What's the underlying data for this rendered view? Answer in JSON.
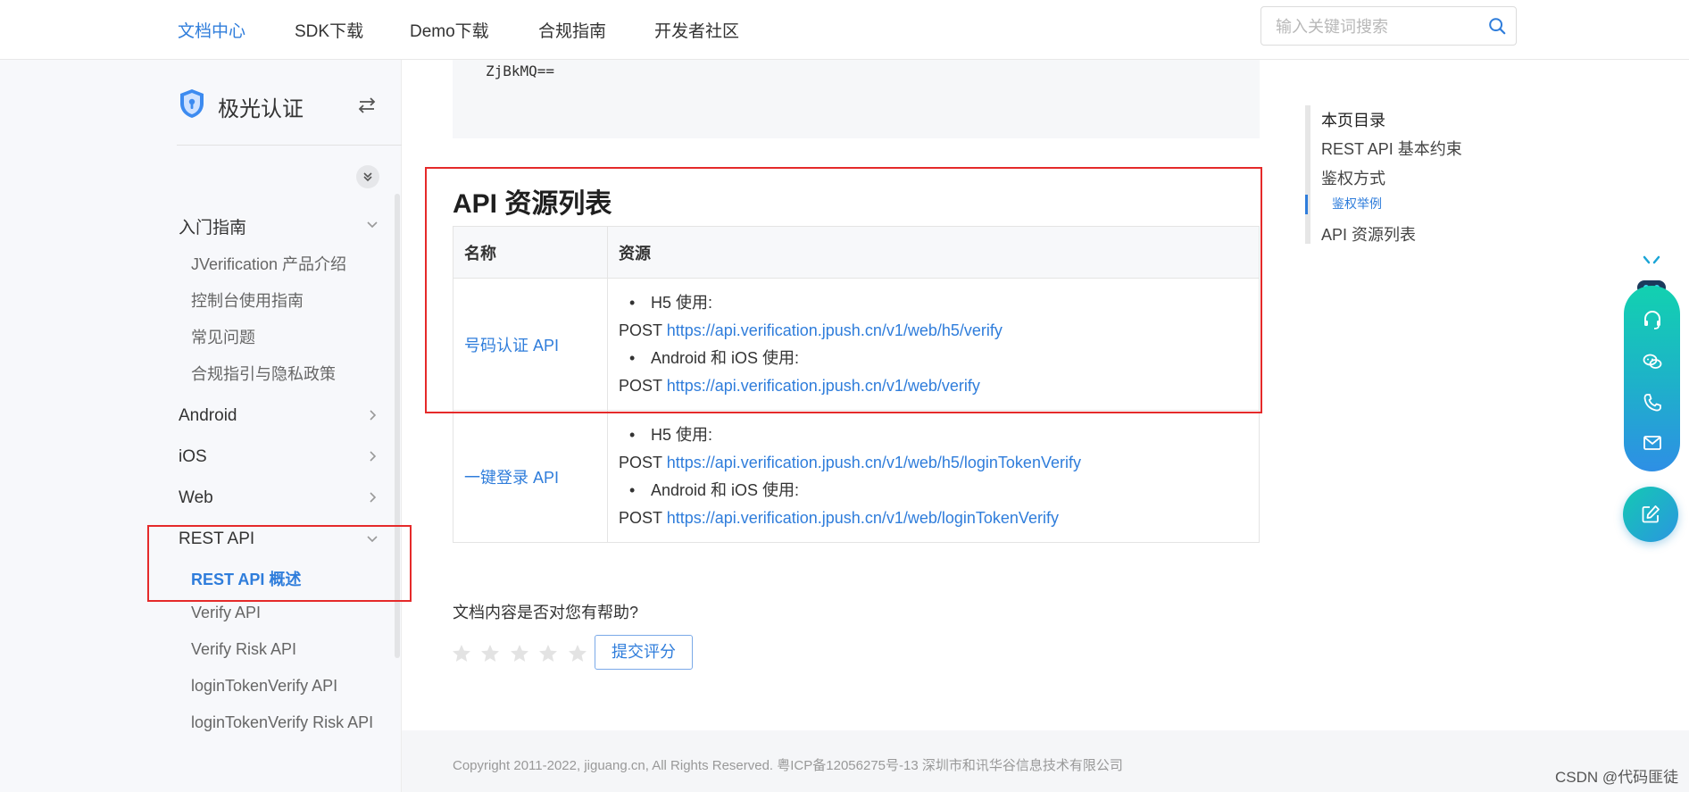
{
  "topnav": {
    "items": [
      "文档中心",
      "SDK下载",
      "Demo下载",
      "合规指南",
      "开发者社区"
    ],
    "search_placeholder": "输入关键词搜索"
  },
  "sidebar": {
    "brand": "极光认证",
    "groups": [
      {
        "label": "入门指南",
        "expanded": true
      },
      {
        "label": "Android",
        "expanded": false
      },
      {
        "label": "iOS",
        "expanded": false
      },
      {
        "label": "Web",
        "expanded": false
      },
      {
        "label": "REST API",
        "expanded": true
      }
    ],
    "intro_items": [
      "JVerification 产品介绍",
      "控制台使用指南",
      "常见问题",
      "合规指引与隐私政策"
    ],
    "rest_items": [
      "REST API 概述",
      "Verify API",
      "Verify Risk API",
      "loginTokenVerify API",
      "loginTokenVerify Risk API"
    ],
    "active_item": "REST API 概述"
  },
  "main": {
    "code_text": "ZjBkMQ==",
    "section_title": "API 资源列表",
    "table": {
      "headers": [
        "名称",
        "资源"
      ],
      "rows": [
        {
          "name": "号码认证 API",
          "h5_label": "H5 使用:",
          "h5_method": "POST",
          "h5_url": "https://api.verification.jpush.cn/v1/web/h5/verify",
          "native_label": "Android 和 iOS 使用:",
          "native_method": "POST",
          "native_url": "https://api.verification.jpush.cn/v1/web/verify"
        },
        {
          "name": "一键登录 API",
          "h5_label": "H5 使用:",
          "h5_method": "POST",
          "h5_url": "https://api.verification.jpush.cn/v1/web/h5/loginTokenVerify",
          "native_label": "Android 和 iOS 使用:",
          "native_method": "POST",
          "native_url": "https://api.verification.jpush.cn/v1/web/loginTokenVerify"
        }
      ]
    },
    "feedback": {
      "question": "文档内容是否对您有帮助?",
      "rating": 0,
      "max_rating": 5,
      "submit_label": "提交评分"
    }
  },
  "toc": {
    "title": "本页目录",
    "items": [
      "REST API 基本约束",
      "鉴权方式",
      "鉴权举例",
      "API 资源列表"
    ],
    "active": "鉴权举例"
  },
  "footer": {
    "copyright": "Copyright 2011-2022, jiguang.cn, All Rights Reserved. 粤ICP备12056275号-13 深圳市和讯华谷信息技术有限公司",
    "watermark": "CSDN @代码匪徒"
  },
  "widget": {
    "icons": [
      "headset-icon",
      "wechat-icon",
      "phone-icon",
      "mail-icon",
      "edit-icon"
    ]
  },
  "colors": {
    "accent": "#2f7ddb",
    "highlight": "#e52a2a",
    "widget_top": "#12d1b0",
    "widget_bottom": "#2e8fe5"
  }
}
